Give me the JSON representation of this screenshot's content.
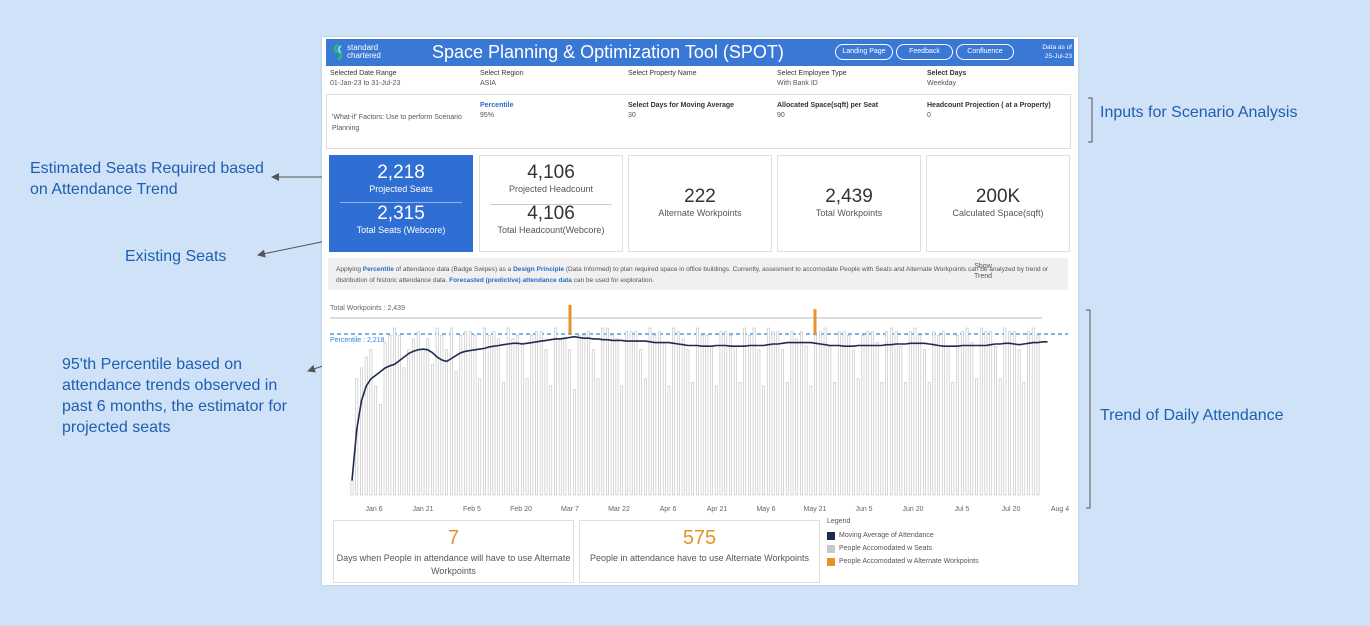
{
  "callouts": {
    "estimated": "Estimated Seats Required based on Attendance Trend",
    "existing": "Existing Seats",
    "percentile": "95'th Percentile based on attendance trends observed in past 6 months, the estimator for projected seats",
    "inputs": "Inputs for Scenario Analysis",
    "trend": "Trend of Daily Attendance"
  },
  "header": {
    "logo_text_1": "standard",
    "logo_text_2": "chartered",
    "title": "Space Planning & Optimization Tool (SPOT)",
    "buttons": [
      "Landing Page",
      "Feedback",
      "Confluence"
    ],
    "data_as_of_label": "Data as of",
    "data_as_of_value": "25-Jul-23",
    "brand_color": "#3a78d6"
  },
  "filters": [
    {
      "label": "Selected Date Range",
      "value": "01-Jan-23 to 31-Jul-23"
    },
    {
      "label": "Select Region",
      "value": "ASIA"
    },
    {
      "label": "Select Property Name",
      "value": ""
    },
    {
      "label": "Select Employee Type",
      "value": "With Bank ID"
    },
    {
      "label": "Select Days",
      "value": "Weekday"
    }
  ],
  "what_if": {
    "label": "'What-if' Factors: Use to perform Scenario Planning",
    "params": [
      {
        "label": "Percentile",
        "value": "95%"
      },
      {
        "label": "Select  Days for Moving Average",
        "value": "30"
      },
      {
        "label": "Allocated Space(sqft) per Seat",
        "value": "90"
      },
      {
        "label": "Headcount Projection ( at a Property)",
        "value": "0"
      }
    ]
  },
  "kpis": {
    "projected_seats": {
      "value": "2,218",
      "label": "Projected Seats"
    },
    "total_seats": {
      "value": "2,315",
      "label": "Total Seats (Webcore)"
    },
    "projected_headcount": {
      "value": "4,106",
      "label": "Projected Headcount"
    },
    "total_headcount": {
      "value": "4,106",
      "label": "Total Headcount(Webcore)"
    },
    "alternate_workpoints": {
      "value": "222",
      "label": "Alternate Workpoints"
    },
    "total_workpoints": {
      "value": "2,439",
      "label": "Total Workpoints"
    },
    "calculated_space": {
      "value": "200K",
      "label": "Calculated Space(sqft)"
    }
  },
  "note": {
    "p1": "Applying ",
    "h1": "Percentile",
    "p2": " of attendance data (Badge Swipes) as a ",
    "h2": "Design Principle",
    "p3": " (Data Informed) to plan required space in office buildings. Currently, assesment to accomodate People with Seats and Alternate Workpoints can be analyzed by trend or distribution of historic attendance data. ",
    "h3": "Forecasted (predictive) attendance data",
    "p4": " can be used for exploration.",
    "show_trend": "Show Trend"
  },
  "chart_data": {
    "type": "bar",
    "ref_lines": [
      {
        "label": "Total Workpoints : 2,439",
        "value": 2439
      },
      {
        "label": "Percentile : 2,218",
        "value": 2218
      }
    ],
    "x_ticks": [
      "Jan 6",
      "Jan 21",
      "Feb 5",
      "Feb 20",
      "Mar 7",
      "Mar 22",
      "Apr 6",
      "Apr 21",
      "May 6",
      "May 21",
      "Jun 5",
      "Jun 20",
      "Jul 5",
      "Jul 20",
      "Aug 4"
    ],
    "ylim": [
      0,
      2700
    ],
    "series": [
      {
        "name": "People Accomodated w Seats",
        "color": "#c8c8c8",
        "values": [
          200,
          1600,
          1750,
          1900,
          2000,
          1500,
          1250,
          2100,
          2200,
          2300,
          2200,
          1750,
          2000,
          2150,
          2250,
          2000,
          2150,
          1800,
          2300,
          2200,
          2000,
          2300,
          1700,
          2200,
          2250,
          2250,
          2200,
          1600,
          2300,
          2200,
          2250,
          2150,
          1550,
          2300,
          2150,
          2200,
          2100,
          1600,
          2200,
          2250,
          2250,
          2000,
          1500,
          2300,
          2150,
          2150,
          2000,
          1450,
          2200,
          2200,
          2250,
          2000,
          1600,
          2300,
          2300,
          2200,
          2150,
          1500,
          2250,
          2250,
          2250,
          2000,
          1600,
          2300,
          2200,
          2250,
          2100,
          1500,
          2300,
          2250,
          2150,
          2000,
          1550,
          2300,
          2200,
          2200,
          2050,
          1500,
          2250,
          2250,
          2200,
          2050,
          1550,
          2300,
          2200,
          2300,
          2000,
          1500,
          2300,
          2250,
          2250,
          2000,
          1550,
          2250,
          2150,
          2250,
          2050,
          1500,
          2200,
          2250,
          2300,
          2050,
          1550,
          2250,
          2250,
          2200,
          2000,
          1600,
          2200,
          2250,
          2250,
          2100,
          1550,
          2250,
          2300,
          2250,
          2050,
          1550,
          2250,
          2300,
          2200,
          2000,
          1550,
          2250,
          2200,
          2250,
          2050,
          1550,
          2200,
          2250,
          2300,
          2100,
          1600,
          2300,
          2250,
          2250,
          2050,
          1600,
          2300,
          2250,
          2250,
          2000,
          1550,
          2250,
          2300,
          2200
        ]
      },
      {
        "name": "People Accomodated w Alternate Workpoints",
        "color": "#e8922a",
        "values": [
          0,
          0,
          0,
          0,
          0,
          0,
          0,
          0,
          0,
          0,
          0,
          0,
          0,
          0,
          0,
          0,
          0,
          0,
          0,
          0,
          0,
          0,
          0,
          0,
          0,
          0,
          0,
          0,
          0,
          0,
          0,
          0,
          0,
          0,
          0,
          0,
          0,
          0,
          0,
          0,
          0,
          0,
          0,
          0,
          0,
          0,
          0,
          0,
          0,
          0,
          0,
          0,
          0,
          0,
          0,
          0,
          0,
          0,
          0,
          0,
          0,
          0,
          0,
          0,
          0,
          0,
          0,
          0,
          0,
          0,
          0,
          0,
          0,
          0,
          0,
          0,
          0,
          0,
          0,
          0,
          0,
          0,
          0,
          0,
          0,
          0,
          0,
          0,
          0,
          0,
          0,
          0,
          0,
          0,
          0,
          0,
          0,
          0,
          0,
          0,
          0,
          0,
          0,
          0,
          0,
          0,
          0,
          0,
          0,
          0,
          0,
          0,
          0,
          0,
          0,
          0,
          0,
          0,
          0,
          0,
          0,
          0,
          0,
          0,
          0,
          0,
          0,
          0,
          0,
          0,
          0,
          0,
          0,
          0,
          0,
          0,
          0,
          0,
          0,
          0,
          0,
          0,
          0,
          0,
          0,
          0,
          0,
          0
        ]
      },
      {
        "name": "Moving Average of Attendance",
        "color": "#1d2b4f",
        "values": [
          200,
          900,
          1300,
          1500,
          1600,
          1650,
          1700,
          1750,
          1780,
          1800,
          1850,
          1900,
          1950,
          1980,
          2000,
          2010,
          2000,
          1960,
          1900,
          1860,
          1840,
          1880,
          1920,
          1960,
          1980,
          1990,
          2000,
          2010,
          2020,
          2040,
          2050,
          2060,
          2070,
          2080,
          2090,
          2090,
          2080,
          2090,
          2100,
          2110,
          2120,
          2130,
          2140,
          2150,
          2150,
          2160,
          2170,
          2180,
          2170,
          2160,
          2160,
          2150,
          2150,
          2140,
          2140,
          2130,
          2130,
          2130,
          2120,
          2120,
          2120,
          2120,
          2120,
          2110,
          2100,
          2100,
          2100,
          2100,
          2090,
          2080,
          2070,
          2060,
          2060,
          2060,
          2050,
          2050,
          2050,
          2060,
          2060,
          2060,
          2050,
          2050,
          2050,
          2050,
          2060,
          2060,
          2060,
          2060,
          2070,
          2080,
          2080,
          2090,
          2100,
          2100,
          2100,
          2100,
          2100,
          2100,
          2090,
          2080,
          2070,
          2060,
          2060,
          2060,
          2050,
          2050,
          2050,
          2060,
          2060,
          2060,
          2060,
          2060,
          2060,
          2070,
          2070,
          2080,
          2080,
          2080,
          2090,
          2090,
          2090,
          2090,
          2080,
          2070,
          2060,
          2050,
          2050,
          2050,
          2050,
          2060,
          2060,
          2060,
          2060,
          2060,
          2060,
          2070,
          2080,
          2080,
          2090,
          2090,
          2080,
          2070,
          2080,
          2090,
          2100,
          2100,
          2110,
          2110
        ]
      }
    ],
    "spike_markers": [
      {
        "date": "Mar 7",
        "series": "People Accomodated w Alternate Workpoints",
        "value": 2620
      },
      {
        "date": "May 21",
        "series": "People Accomodated w Alternate Workpoints",
        "value": 2560
      }
    ]
  },
  "bottom": {
    "days_value": "7",
    "days_label": "Days when People in attendance will have to use Alternate Workpoints",
    "people_value": "575",
    "people_label": "People in attendance have to use Alternate Workpoints",
    "accent_color": "#e8922a"
  },
  "legend": {
    "title": "Legend",
    "items": [
      {
        "label": "Moving Average of Attendance",
        "color": "#1d2b4f"
      },
      {
        "label": "People Accomodated w Seats",
        "color": "#c8c8c8"
      },
      {
        "label": "People Accomodated w Alternate Workpoints",
        "color": "#e8922a"
      }
    ]
  }
}
